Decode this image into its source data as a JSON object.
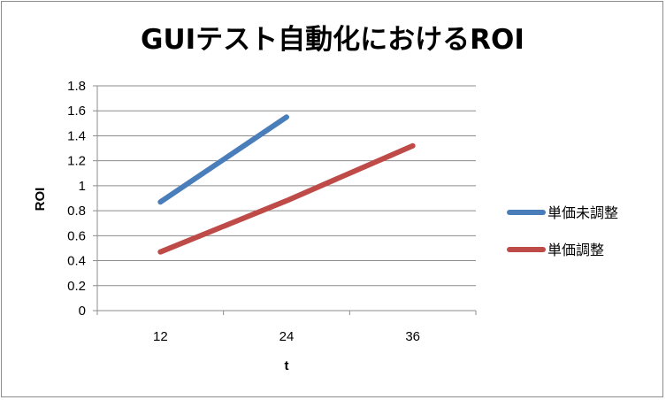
{
  "chart_data": {
    "type": "line",
    "title": "GUIテスト自動化におけるROI",
    "xlabel": "t",
    "ylabel": "ROI",
    "categories": [
      "12",
      "24",
      "36"
    ],
    "ylim": [
      0,
      1.8
    ],
    "yticks": [
      "0",
      "0.2",
      "0.4",
      "0.6",
      "0.8",
      "1",
      "1.2",
      "1.4",
      "1.6",
      "1.8"
    ],
    "grid": true,
    "legend_position": "right",
    "series": [
      {
        "name": "単価未調整",
        "color": "#4a7ebb",
        "values": [
          0.87,
          1.55,
          null
        ]
      },
      {
        "name": "単価調整",
        "color": "#be4b48",
        "values": [
          0.47,
          0.88,
          1.32
        ]
      }
    ]
  }
}
